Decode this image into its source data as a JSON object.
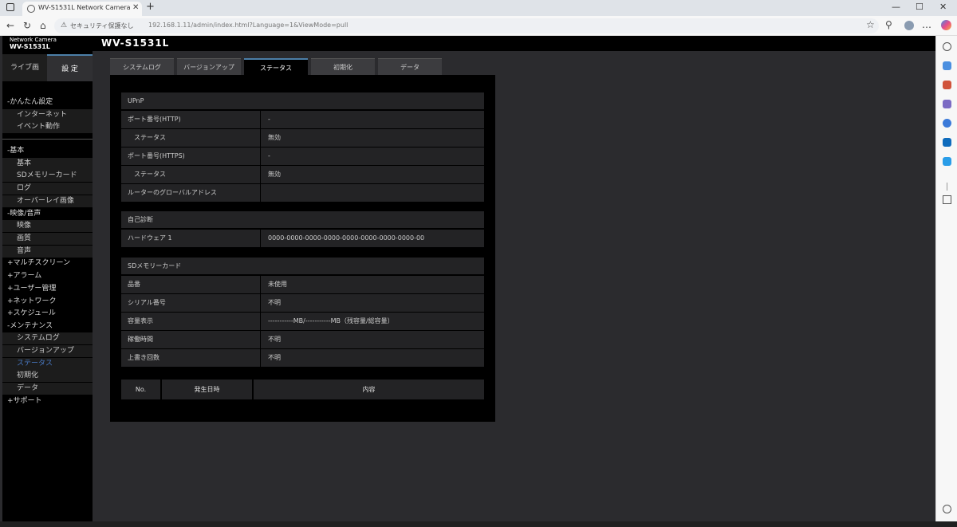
{
  "browser": {
    "tab_title": "WV-S1531L Network Camera",
    "security_label": "セキュリティ保護なし",
    "url": "192.168.1.11/admin/index.html?Language=1&ViewMode=pull",
    "icons": [
      "back-icon",
      "reload-icon",
      "home-icon",
      "info-icon",
      "favorite-icon",
      "extensions-icon",
      "profile-icon",
      "copilot-icon"
    ]
  },
  "header": {
    "logo_line1": "Network Camera",
    "logo_line2": "WV-S1531L",
    "model": "WV-S1531L"
  },
  "left_tabs": {
    "live": "ライブ画",
    "setup": "設 定"
  },
  "nav": [
    {
      "label": "-かんたん設定",
      "type": "head"
    },
    {
      "label": "インターネット",
      "type": "sub"
    },
    {
      "label": "イベント動作",
      "type": "sub"
    },
    {
      "label": "-基本",
      "type": "head"
    },
    {
      "label": "基本",
      "type": "sub"
    },
    {
      "label": "SDメモリーカード",
      "type": "sub"
    },
    {
      "label": "ログ",
      "type": "sub"
    },
    {
      "label": "オーバーレイ画像",
      "type": "sub"
    },
    {
      "label": "-映像/音声",
      "type": "head"
    },
    {
      "label": "映像",
      "type": "sub"
    },
    {
      "label": "画質",
      "type": "sub"
    },
    {
      "label": "音声",
      "type": "sub"
    },
    {
      "label": "+マルチスクリーン",
      "type": "head"
    },
    {
      "label": "+アラーム",
      "type": "head"
    },
    {
      "label": "+ユーザー管理",
      "type": "head"
    },
    {
      "label": "+ネットワーク",
      "type": "head"
    },
    {
      "label": "+スケジュール",
      "type": "head"
    },
    {
      "label": "-メンテナンス",
      "type": "head"
    },
    {
      "label": "システムログ",
      "type": "sub"
    },
    {
      "label": "バージョンアップ",
      "type": "sub"
    },
    {
      "label": "ステータス",
      "type": "sub",
      "active": true
    },
    {
      "label": "初期化",
      "type": "sub"
    },
    {
      "label": "データ",
      "type": "sub"
    },
    {
      "label": "+サポート",
      "type": "head"
    }
  ],
  "main_tabs": [
    "システムログ",
    "バージョンアップ",
    "ステータス",
    "初期化",
    "データ"
  ],
  "active_tab": "ステータス",
  "upnp": {
    "title": "UPnP",
    "rows": [
      {
        "label": "ポート番号(HTTP)",
        "value": "-"
      },
      {
        "label": "ステータス",
        "value": "無効"
      },
      {
        "label": "ポート番号(HTTPS)",
        "value": "-"
      },
      {
        "label": "ステータス",
        "value": "無効"
      },
      {
        "label": "ルーターのグローバルアドレス",
        "value": ""
      }
    ]
  },
  "self_diag": {
    "title": "自己診断",
    "rows": [
      {
        "label": "ハードウェア 1",
        "value": "0000-0000-0000-0000-0000-0000-0000-0000-00"
      }
    ]
  },
  "sd_card": {
    "title": "SDメモリーカード",
    "rows": [
      {
        "label": "品番",
        "value": "未使用"
      },
      {
        "label": "シリアル番号",
        "value": "不明"
      },
      {
        "label": "容量表示",
        "value": "-----------MB/-----------MB（残容量/総容量）"
      },
      {
        "label": "稼働時間",
        "value": "不明"
      },
      {
        "label": "上書き回数",
        "value": "不明"
      }
    ]
  },
  "log_table": {
    "columns": [
      "No.",
      "発生日時",
      "内容"
    ]
  },
  "colors": {
    "accent": "#4c7fa8",
    "active_nav": "#4a7bc8",
    "panel": "#000000",
    "row": "#232325"
  }
}
